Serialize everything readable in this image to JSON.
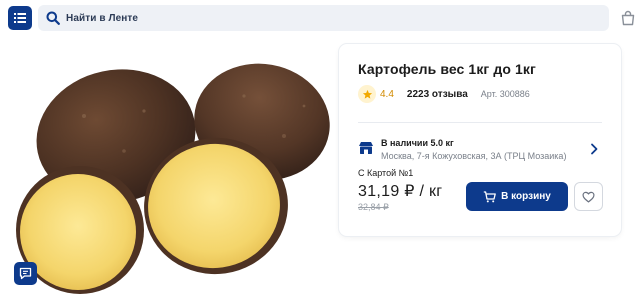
{
  "header": {
    "search_placeholder": "Найти в Ленте",
    "icons": {
      "menu": "list-menu-icon",
      "search": "search-icon",
      "bag": "shopping-bag-icon"
    }
  },
  "product": {
    "title": "Картофель вес 1кг до 1кг",
    "rating": "4.4",
    "reviews": "2223 отзыва",
    "article": "Арт. 300886",
    "availability": {
      "label": "В наличии 5.0 кг",
      "address": "Москва, 7-я Кожуховская, 3А (ТРЦ Мозаика)"
    },
    "card_label": "С Картой №1",
    "price": "31,19 ₽ / кг",
    "old_price": "32,84 ₽",
    "add_to_cart": "В корзину"
  },
  "colors": {
    "brand": "#0d3a8c",
    "rating": "#d18a00",
    "star_bg": "#fff3cf",
    "search_bg": "#eef1f6"
  }
}
